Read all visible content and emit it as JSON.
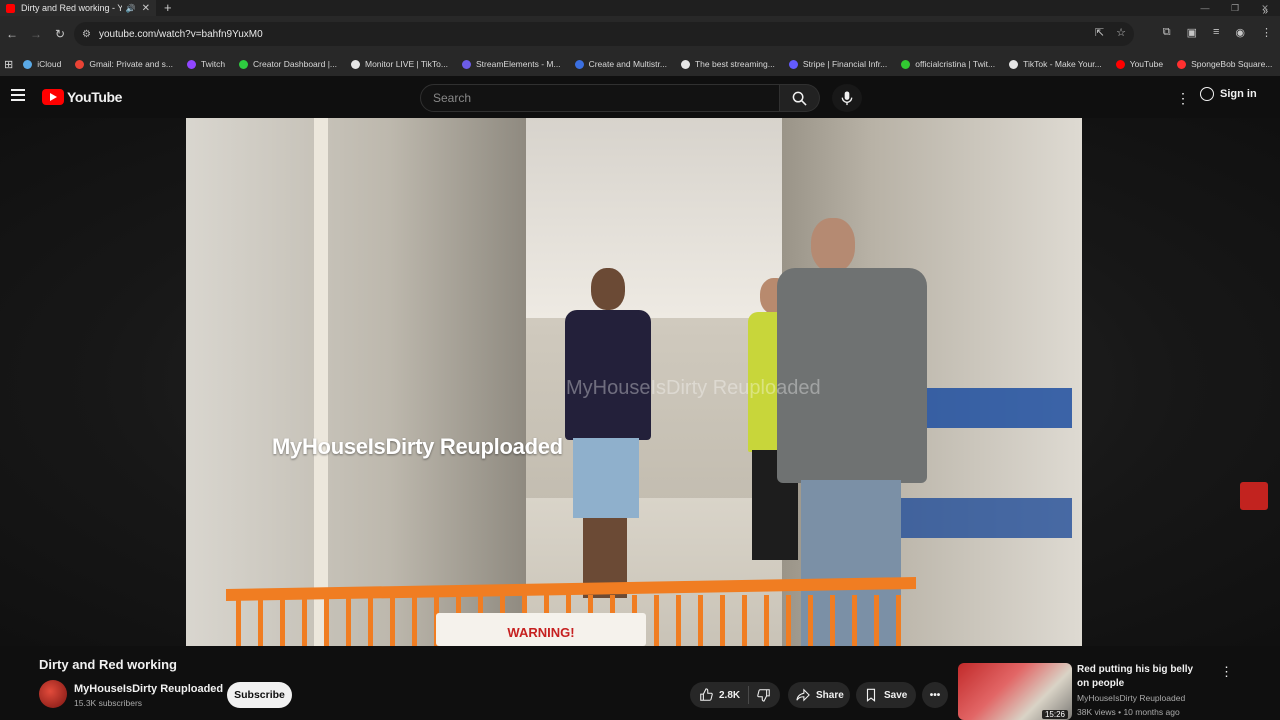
{
  "browser": {
    "tab_title": "Dirty and Red working - Yo",
    "url": "youtube.com/watch?v=bahfn9YuxM0",
    "bookmarks": [
      {
        "label": "iCloud",
        "color": "#5aa9e6"
      },
      {
        "label": "Gmail: Private and s...",
        "color": "#ea4335"
      },
      {
        "label": "Twitch",
        "color": "#9146ff"
      },
      {
        "label": "Creator Dashboard |...",
        "color": "#2ecc40"
      },
      {
        "label": "Monitor LIVE | TikTo...",
        "color": "#e5e5e5"
      },
      {
        "label": "StreamElements - M...",
        "color": "#6c5ce7"
      },
      {
        "label": "Create and Multistr...",
        "color": "#3b6fe0"
      },
      {
        "label": "The best streaming...",
        "color": "#e5e5e5"
      },
      {
        "label": "Stripe | Financial Infr...",
        "color": "#635bff"
      },
      {
        "label": "officialcristina | Twit...",
        "color": "#32c832"
      },
      {
        "label": "TikTok - Make Your...",
        "color": "#e5e5e5"
      },
      {
        "label": "YouTube",
        "color": "#ff0000"
      },
      {
        "label": "SpongeBob Square...",
        "color": "#ff3030"
      }
    ]
  },
  "youtube": {
    "logo_text": "YouTube",
    "search_placeholder": "Search",
    "sign_in": "Sign in"
  },
  "video": {
    "watermark": "MyHouseIsDirty Reuploaded",
    "watermark_faint": "MyHouseIsDirty Reuploaded",
    "cart_label": "WARNING!",
    "title": "Dirty and Red working",
    "channel": "MyHouseIsDirty Reuploaded",
    "subscribers": "15.3K subscribers",
    "subscribe_label": "Subscribe",
    "likes": "2.8K",
    "share_label": "Share",
    "save_label": "Save"
  },
  "up_next": {
    "title": "Red putting his big belly on people",
    "channel": "MyHouseIsDirty Reuploaded",
    "meta": "38K views • 10 months ago",
    "duration": "15:26"
  }
}
